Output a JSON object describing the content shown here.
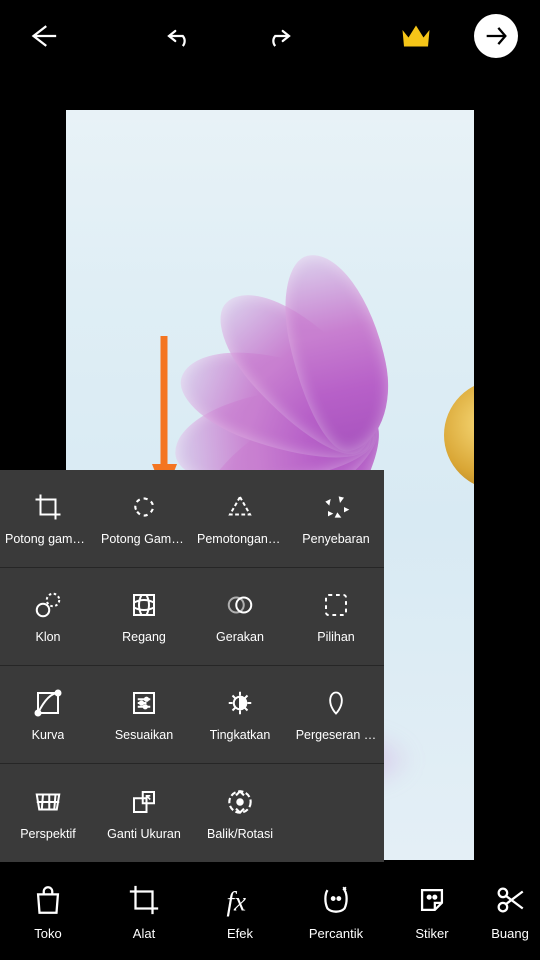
{
  "header": {
    "back": "back",
    "undo": "undo",
    "redo": "redo",
    "premium": "premium",
    "next": "next"
  },
  "pointer_color": "#f47521",
  "tool_panel": {
    "rows": [
      [
        {
          "icon": "crop",
          "label": "Potong gamb…"
        },
        {
          "icon": "freecrop",
          "label": "Potong Gamb…"
        },
        {
          "icon": "shapecrop",
          "label": "Pemotongan …"
        },
        {
          "icon": "disperse",
          "label": "Penyebaran"
        }
      ],
      [
        {
          "icon": "clone",
          "label": "Klon"
        },
        {
          "icon": "stretch",
          "label": "Regang"
        },
        {
          "icon": "motion",
          "label": "Gerakan"
        },
        {
          "icon": "select",
          "label": "Pilihan"
        }
      ],
      [
        {
          "icon": "curve",
          "label": "Kurva"
        },
        {
          "icon": "adjust",
          "label": "Sesuaikan"
        },
        {
          "icon": "enhance",
          "label": "Tingkatkan"
        },
        {
          "icon": "tiltshift",
          "label": "Pergeseran …"
        }
      ],
      [
        {
          "icon": "perspective",
          "label": "Perspektif"
        },
        {
          "icon": "resize",
          "label": "Ganti Ukuran"
        },
        {
          "icon": "fliprotate",
          "label": "Balik/Rotasi"
        },
        {
          "icon": "empty",
          "label": ""
        }
      ]
    ]
  },
  "bottom_nav": [
    {
      "icon": "shop",
      "label": "Toko"
    },
    {
      "icon": "tools",
      "label": "Alat"
    },
    {
      "icon": "effects",
      "label": "Efek"
    },
    {
      "icon": "beautify",
      "label": "Percantik"
    },
    {
      "icon": "sticker",
      "label": "Stiker"
    },
    {
      "icon": "cutout",
      "label": "Buang"
    }
  ]
}
